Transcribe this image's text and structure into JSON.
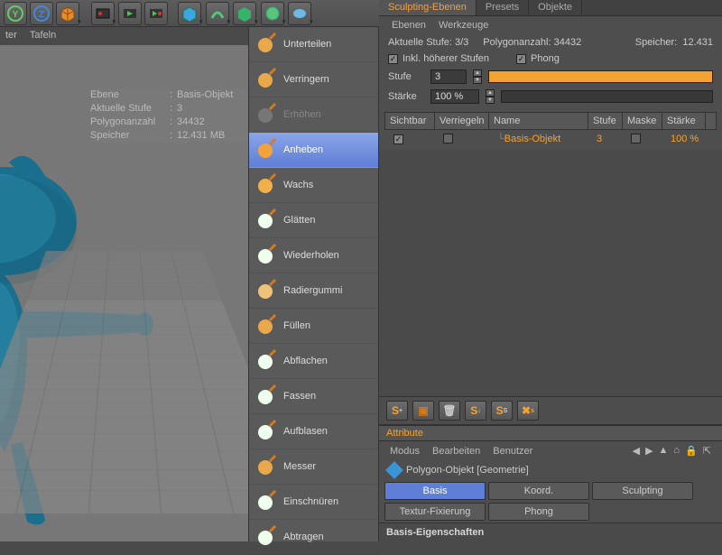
{
  "toolbar_icons": [
    "axis-y",
    "axis-z",
    "cube",
    "clapper-1",
    "clapper-2",
    "clapper-3",
    "prim-cube",
    "prim-torus",
    "prim-leaf",
    "prim-gear",
    "prim-blob"
  ],
  "top_tabs": [
    "ter",
    "Tafeln"
  ],
  "viewport_info": {
    "rows": [
      {
        "k": "Ebene",
        "v": "Basis-Objekt"
      },
      {
        "k": "Aktuelle Stufe",
        "v": "3"
      },
      {
        "k": "Polygonanzahl",
        "v": "34432"
      },
      {
        "k": "Speicher",
        "v": "12.431 MB"
      }
    ]
  },
  "sculpt_tools": [
    {
      "label": "Unterteilen",
      "disabled": false
    },
    {
      "label": "Verringern",
      "disabled": false
    },
    {
      "label": "Erhöhen",
      "disabled": true
    },
    {
      "label": "Anheben",
      "active": true
    },
    {
      "label": "Wachs"
    },
    {
      "label": "Glätten"
    },
    {
      "label": "Wiederholen"
    },
    {
      "label": "Radiergummi"
    },
    {
      "label": "Füllen"
    },
    {
      "label": "Abflachen"
    },
    {
      "label": "Fassen"
    },
    {
      "label": "Aufblasen"
    },
    {
      "label": "Messer"
    },
    {
      "label": "Einschnüren"
    },
    {
      "label": "Abtragen"
    }
  ],
  "panel_tabs": [
    {
      "label": "Sculpting-Ebenen",
      "active": true
    },
    {
      "label": "Presets"
    },
    {
      "label": "Objekte"
    }
  ],
  "panel_subtabs": [
    "Ebenen",
    "Werkzeuge"
  ],
  "status": {
    "stufe_label": "Aktuelle Stufe:",
    "stufe": "3/3",
    "poly_label": "Polygonanzahl:",
    "poly": "34432",
    "mem_label": "Speicher:",
    "mem": "12.431"
  },
  "checks": {
    "inkl_label": "Inkl. höherer Stufen",
    "inkl": true,
    "phong_label": "Phong",
    "phong": true
  },
  "stufe_field": {
    "label": "Stufe",
    "value": "3",
    "slider_pct": 100
  },
  "staerke_field": {
    "label": "Stärke",
    "value": "100 %",
    "slider_pct": 0
  },
  "layer_cols": [
    "Sichtbar",
    "Verriegeln",
    "Name",
    "Stufe",
    "Maske",
    "Stärke"
  ],
  "layer_row": {
    "visible": true,
    "locked": false,
    "name": "Basis-Objekt",
    "stufe": "3",
    "mask": false,
    "strength": "100 %"
  },
  "attribute": {
    "title": "Attribute",
    "menus": [
      "Modus",
      "Bearbeiten",
      "Benutzer"
    ],
    "object": "Polygon-Objekt [Geometrie]",
    "tabs": [
      {
        "l": "Basis",
        "a": true
      },
      {
        "l": "Koord."
      },
      {
        "l": "Sculpting"
      },
      {
        "l": "Textur-Fixierung"
      },
      {
        "l": "Phong"
      }
    ],
    "section": "Basis-Eigenschaften"
  }
}
